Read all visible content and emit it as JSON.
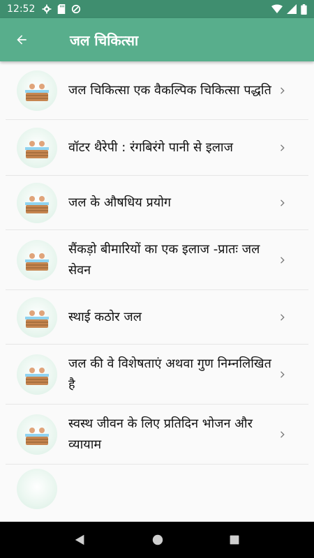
{
  "status": {
    "time": "12:52",
    "icons": [
      "gear-icon",
      "sd-card-icon",
      "data-saver-icon",
      "wifi-icon",
      "cell-signal-icon",
      "battery-icon"
    ]
  },
  "appbar": {
    "title": "जल चिकित्सा",
    "back_icon": "arrow-back-icon"
  },
  "list": {
    "items": [
      {
        "label": "जल चिकित्सा एक वैकल्पिक चिकित्सा पद्धति"
      },
      {
        "label": "वॉटर थैरेपी : रंगबिरंगे पानी से इलाज"
      },
      {
        "label": "जल के औषधिय प्रयोग"
      },
      {
        "label": "सैंकड़ो बीमारियों का एक इलाज -प्रातः जल सेवन"
      },
      {
        "label": "स्थाई कठोर जल"
      },
      {
        "label": "जल की वे विशेषताएं अथवा गुण निम्नलिखित है"
      },
      {
        "label": "स्वस्थ जीवन के लिए प्रतिदिन भोजन और व्यायाम"
      }
    ]
  },
  "colors": {
    "statusbar": "#3f8e6f",
    "appbar": "#58ae8c"
  }
}
